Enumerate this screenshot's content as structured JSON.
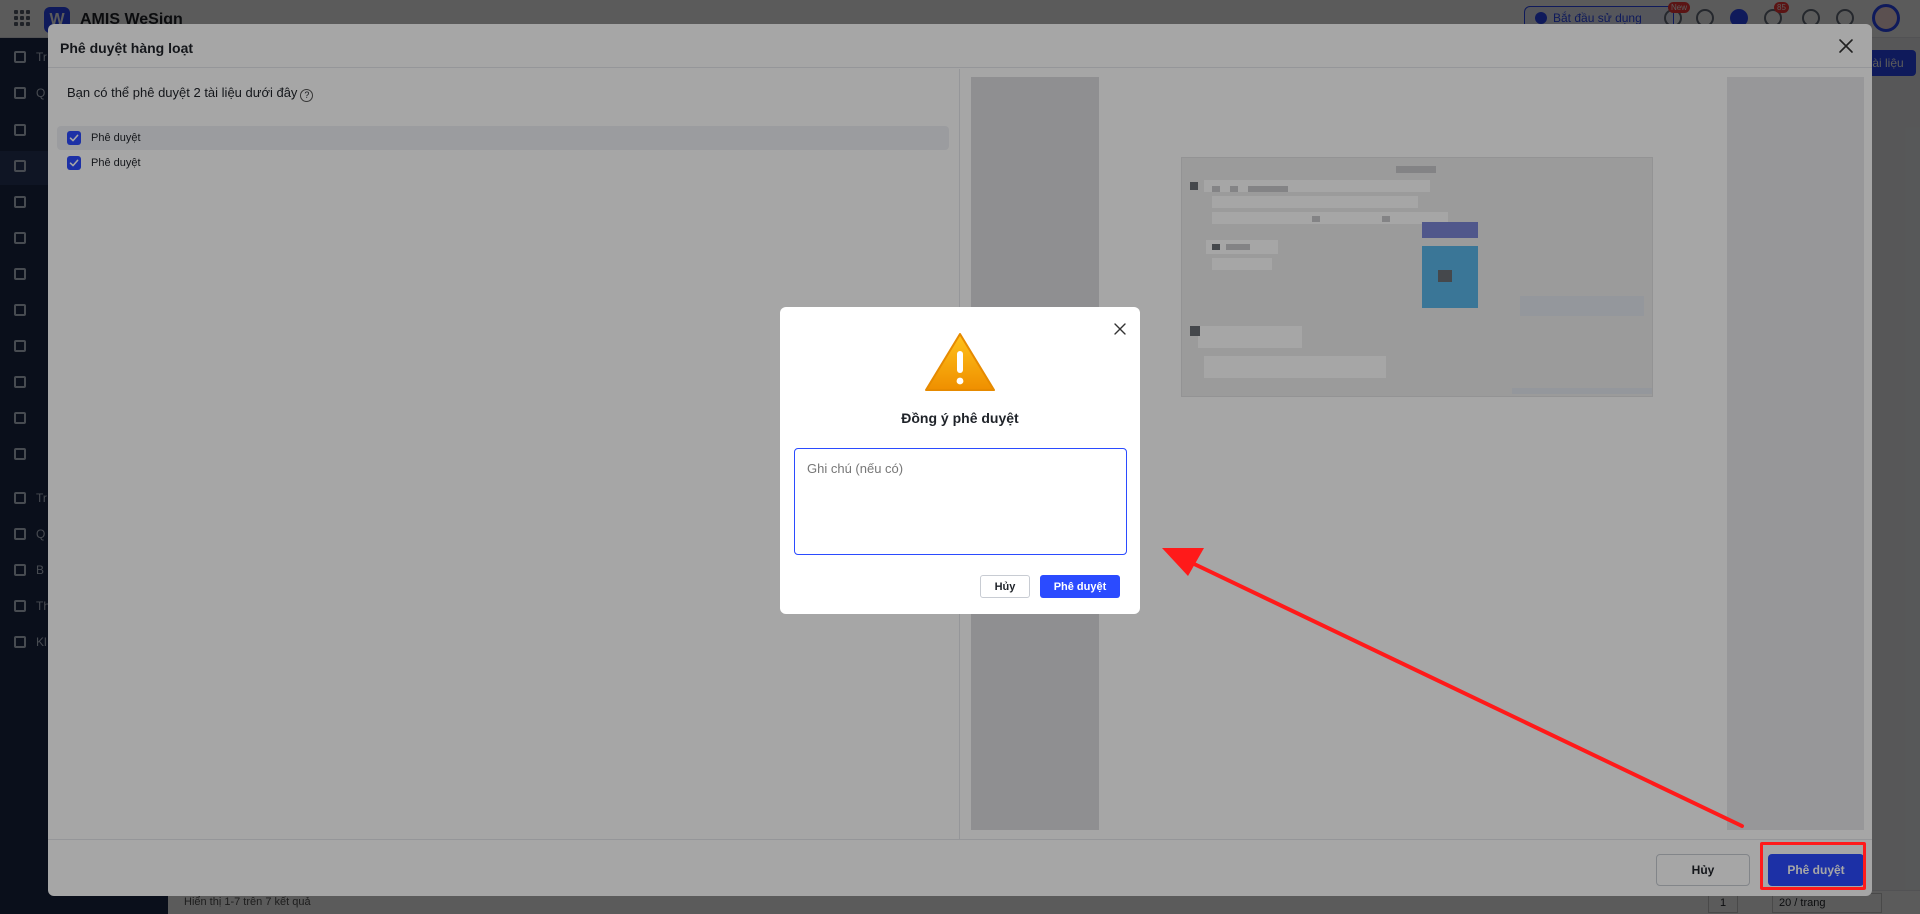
{
  "app": {
    "name": "AMIS WeSign",
    "start_button": "Bắt đầu sử dụng",
    "new_badge": "New",
    "notification_count": "85",
    "avatar_count": "1",
    "right_button": "ài liệu"
  },
  "sidebar": {
    "items": [
      {
        "label": "Tr",
        "icon": "home-icon"
      },
      {
        "label": "Q",
        "icon": "document-icon"
      },
      {
        "label": "",
        "icon": "clock-icon"
      },
      {
        "label": "",
        "icon": "user-edit-icon"
      },
      {
        "label": "",
        "icon": "history-icon"
      },
      {
        "label": "",
        "icon": "check-circle-icon"
      },
      {
        "label": "",
        "icon": "chevron-up-icon"
      },
      {
        "label": "",
        "icon": "inbox-icon"
      },
      {
        "label": "",
        "icon": "send-icon"
      },
      {
        "label": "",
        "icon": "file-icon"
      },
      {
        "label": "",
        "icon": "trash-icon"
      },
      {
        "label": "",
        "icon": "folder-icon"
      },
      {
        "label": "Tr",
        "icon": "tools-icon"
      },
      {
        "label": "Q",
        "icon": "table-icon"
      },
      {
        "label": "B",
        "icon": "chart-icon"
      },
      {
        "label": "Th",
        "icon": "settings-icon"
      },
      {
        "label": "Kl",
        "icon": "book-icon"
      }
    ]
  },
  "footer": {
    "results": "Hiển thị 1-7 trên 7 kết quả",
    "page": "1",
    "page_size": "20 / trang"
  },
  "batch_dialog": {
    "title": "Phê duyệt hàng loạt",
    "intro": "Bạn có thể phê duyệt 2 tài liệu dưới đây",
    "documents": [
      {
        "label": "Phê duyệt",
        "checked": true
      },
      {
        "label": "Phê duyệt",
        "checked": true
      }
    ],
    "cancel_label": "Hủy",
    "approve_label": "Phê duyệt"
  },
  "confirm_modal": {
    "title": "Đồng ý phê duyệt",
    "note_placeholder": "Ghi chú (nếu có)",
    "cancel_label": "Hủy",
    "approve_label": "Phê duyệt",
    "warning_icon": "warning-icon"
  },
  "colors": {
    "primary": "#2b4bff",
    "annotation": "#ff1a1a",
    "warning": "#f2a80a"
  }
}
